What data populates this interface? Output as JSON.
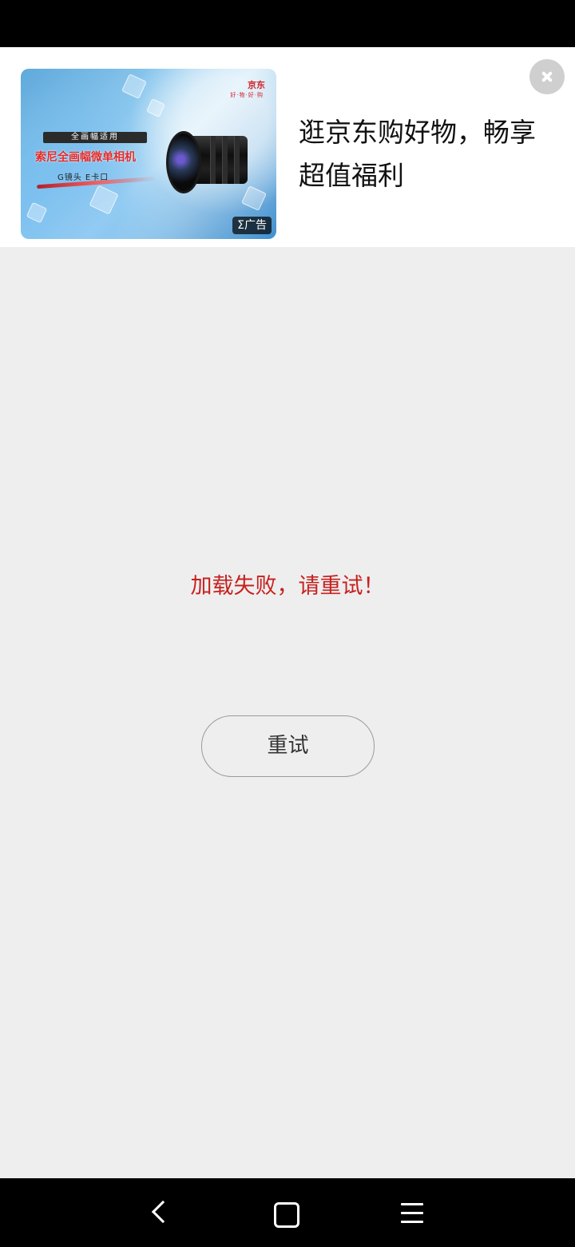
{
  "ad": {
    "title": "逛京东购好物，畅享超值福利",
    "badge": "Σ广告",
    "image": {
      "brand": "京东",
      "brand_sub": "好·物·好·购",
      "tagline": "全画幅适用",
      "product": "索尼全画幅微单相机",
      "subline": "G镜头 E卡口"
    }
  },
  "error": {
    "message": "加载失败，请重试！",
    "retry_label": "重试"
  },
  "colors": {
    "error_text": "#c6211e",
    "background": "#eeeeef"
  },
  "nav": {
    "icons": [
      "back-icon",
      "home-icon",
      "menu-icon"
    ]
  }
}
